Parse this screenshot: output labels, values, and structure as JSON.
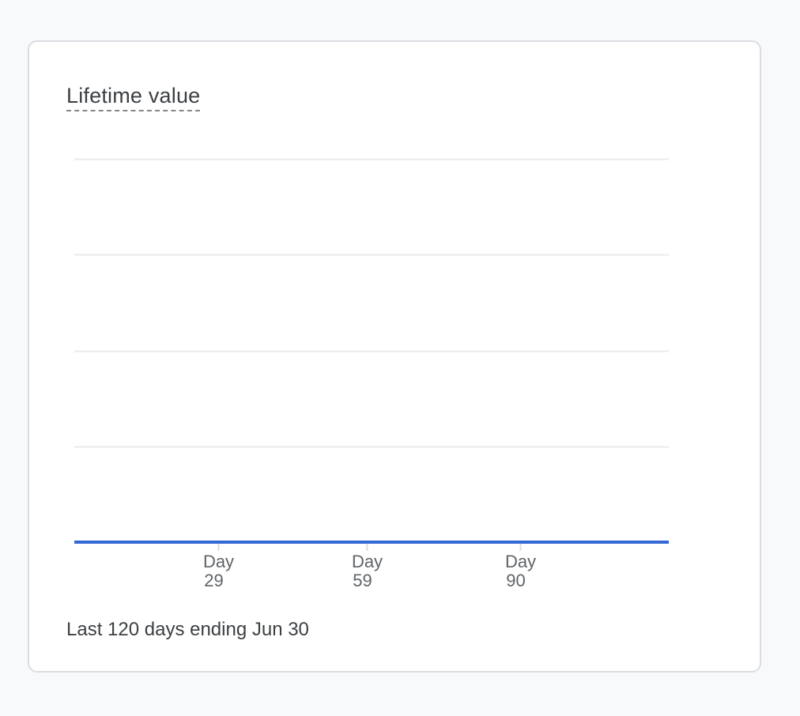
{
  "card": {
    "title": "Lifetime value",
    "footer": "Last 120 days ending Jun 30"
  },
  "chart_data": {
    "type": "line",
    "title": "Lifetime value",
    "xlabel": "",
    "ylabel": "",
    "x_ticks": [
      {
        "day": 29,
        "line1": "Day",
        "line2": "29"
      },
      {
        "day": 59,
        "line1": "Day",
        "line2": "59"
      },
      {
        "day": 90,
        "line1": "Day",
        "line2": "90"
      }
    ],
    "xlim": [
      0,
      120
    ],
    "ylim": [
      0,
      4
    ],
    "grid": true,
    "gridline_count": 5,
    "series": [
      {
        "color": "#3367d6",
        "x": [
          0,
          120
        ],
        "values": [
          0,
          0
        ]
      }
    ]
  },
  "colors": {
    "series": "#3367d6",
    "gridline": "#e8eaed",
    "tick": "#dadce0",
    "text": "#3c4043",
    "muted_text": "#5f6368"
  }
}
